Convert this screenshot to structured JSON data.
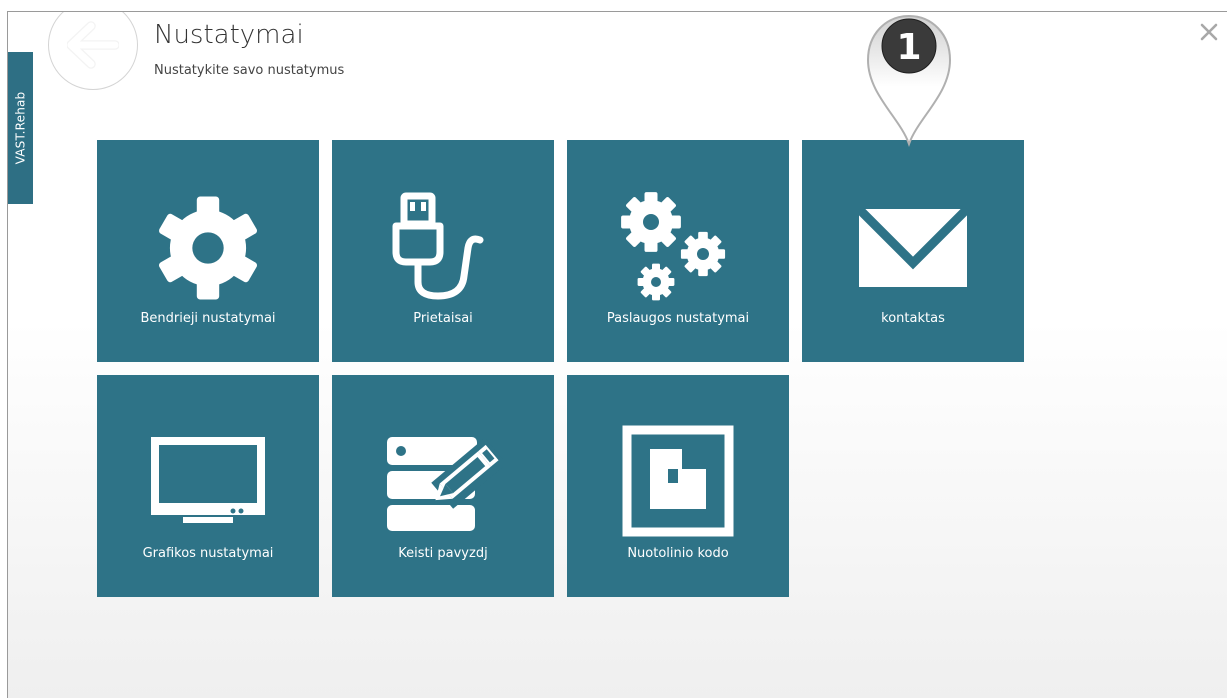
{
  "app": {
    "side_tab": "VAST.Rehab",
    "title": "Nustatymai",
    "subtitle": "Nustatykite savo nustatymus"
  },
  "colors": {
    "tile": "#2e7387",
    "side_tab": "#2e6f84"
  },
  "tiles": [
    {
      "label": "Bendrieji nustatymai",
      "icon": "gear-icon"
    },
    {
      "label": "Prietaisai",
      "icon": "usb-cable-icon"
    },
    {
      "label": "Paslaugos nustatymai",
      "icon": "gears-icon"
    },
    {
      "label": "kontaktas",
      "icon": "envelope-icon"
    },
    {
      "label": "Grafikos nustatymai",
      "icon": "monitor-icon"
    },
    {
      "label": "Keisti pavyzdj",
      "icon": "edit-template-icon"
    },
    {
      "label": "Nuotolinio kodo",
      "icon": "remote-code-icon"
    }
  ],
  "marker": {
    "number": "1",
    "icon": "map-pin-icon"
  }
}
